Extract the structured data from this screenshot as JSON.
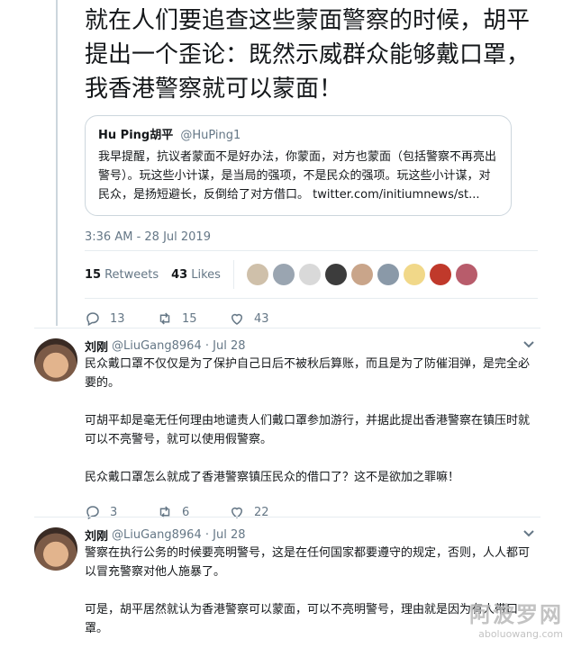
{
  "main_tweet": {
    "text": "就在人们要追查这些蒙面警察的时候，胡平提出一个歪论：既然示威群众能够戴口罩，我香港警察就可以蒙面！",
    "quote": {
      "name": "Hu Ping胡平",
      "handle": "@HuPing1",
      "text": "我早提醒，抗议者蒙面不是好办法，你蒙面，对方也蒙面（包括警察不再亮出警号）。玩这些小计谋，是当局的强项，不是民众的强项。玩这些小计谋，对民众，是扬短避长，反倒给了对方借口。",
      "link": "twitter.com/initiumnews/st..."
    },
    "timestamp": "3:36 AM - 28 Jul 2019",
    "retweets_count": "15",
    "retweets_label": "Retweets",
    "likes_count": "43",
    "likes_label": "Likes",
    "actions": {
      "replies": "13",
      "retweets": "15",
      "likes": "43"
    },
    "liker_colors": [
      "#cfc0aa",
      "#9aa5b1",
      "#d9d9d9",
      "#3c3c3c",
      "#c9a58a",
      "#8a99a8",
      "#f1d889",
      "#c0392b",
      "#b85c6b"
    ]
  },
  "replies": [
    {
      "name": "刘刚",
      "handle": "@LiuGang8964",
      "date": "Jul 28",
      "paragraphs": [
        "民众戴口罩不仅仅是为了保护自己日后不被秋后算账，而且是为了防催泪弹，是完全必要的。",
        "可胡平却是毫无任何理由地谴责人们戴口罩参加游行，并据此提出香港警察在镇压时就可以不亮警号，就可以使用假警察。",
        "民众戴口罩怎么就成了香港警察镇压民众的借口了？这不是欲加之罪嘛！"
      ],
      "actions": {
        "replies": "3",
        "retweets": "6",
        "likes": "22"
      }
    },
    {
      "name": "刘刚",
      "handle": "@LiuGang8964",
      "date": "Jul 28",
      "paragraphs": [
        "警察在执行公务的时候要亮明警号，这是在任何国家都要遵守的规定，否则，人人都可以冒充警察对他人施暴了。",
        "可是，胡平居然就认为香港警察可以蒙面，可以不亮明警号，理由就是因为有人带口罩。"
      ]
    }
  ],
  "watermark": {
    "big": "阿波罗网",
    "small": "aboluowang.com"
  }
}
